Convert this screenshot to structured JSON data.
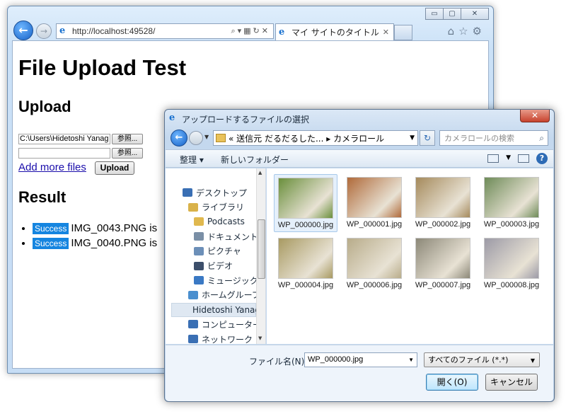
{
  "browser": {
    "url": "http://localhost:49528/",
    "tab_title": "マイ サイトのタイトル",
    "window_buttons": [
      "▭",
      "▢",
      "✕"
    ]
  },
  "page": {
    "title": "File Upload Test",
    "upload_heading": "Upload",
    "file1_value": "C:\\Users\\Hidetoshi Yanag",
    "file2_value": "",
    "browse_label": "参照...",
    "add_more_label": "Add more files",
    "upload_button": "Upload",
    "result_heading": "Result",
    "results": [
      {
        "badge": "Success",
        "text": "IMG_0043.PNG is"
      },
      {
        "badge": "Success",
        "text": "IMG_0040.PNG is"
      }
    ]
  },
  "dialog": {
    "title": "アップロードするファイルの選択",
    "close_label": "✕",
    "path": "« 送信元 だるだるした... ▸ カメラロール",
    "search_placeholder": "カメラロールの検索",
    "toolbar": {
      "organize": "整理 ▾",
      "new_folder": "新しいフォルダー"
    },
    "nav_items": [
      {
        "label": "デスクトップ",
        "color": "#3a6fb4"
      },
      {
        "label": "ライブラリ",
        "color": "#d9b24a"
      },
      {
        "label": "Podcasts",
        "color": "#e0b84e"
      },
      {
        "label": "ドキュメント",
        "color": "#7a8fa6"
      },
      {
        "label": "ピクチャ",
        "color": "#6c8fb8"
      },
      {
        "label": "ビデオ",
        "color": "#3c4f6b"
      },
      {
        "label": "ミュージック",
        "color": "#3a79c4"
      },
      {
        "label": "ホームグループ",
        "color": "#4a8fcf"
      },
      {
        "label": "Hidetoshi Yanag",
        "color": "#d2a64a"
      },
      {
        "label": "コンピューター",
        "color": "#3a6fb4"
      },
      {
        "label": "ネットワーク",
        "color": "#3a6fb4"
      }
    ],
    "files": [
      {
        "name": "WP_000000.jpg",
        "color": "#6a8f3c"
      },
      {
        "name": "WP_000001.jpg",
        "color": "#b06a3a"
      },
      {
        "name": "WP_000002.jpg",
        "color": "#a58a5c"
      },
      {
        "name": "WP_000003.jpg",
        "color": "#6e8b58"
      },
      {
        "name": "WP_000004.jpg",
        "color": "#a89a62"
      },
      {
        "name": "WP_000006.jpg",
        "color": "#b8ac8a"
      },
      {
        "name": "WP_000007.jpg",
        "color": "#8c8878"
      },
      {
        "name": "WP_000008.jpg",
        "color": "#9c9aa6"
      }
    ],
    "filename_label": "ファイル名(N):",
    "filename_value": "WP_000000.jpg",
    "filetype_value": "すべてのファイル (*.*)",
    "open_button": "開く(O)",
    "cancel_button": "キャンセル"
  }
}
